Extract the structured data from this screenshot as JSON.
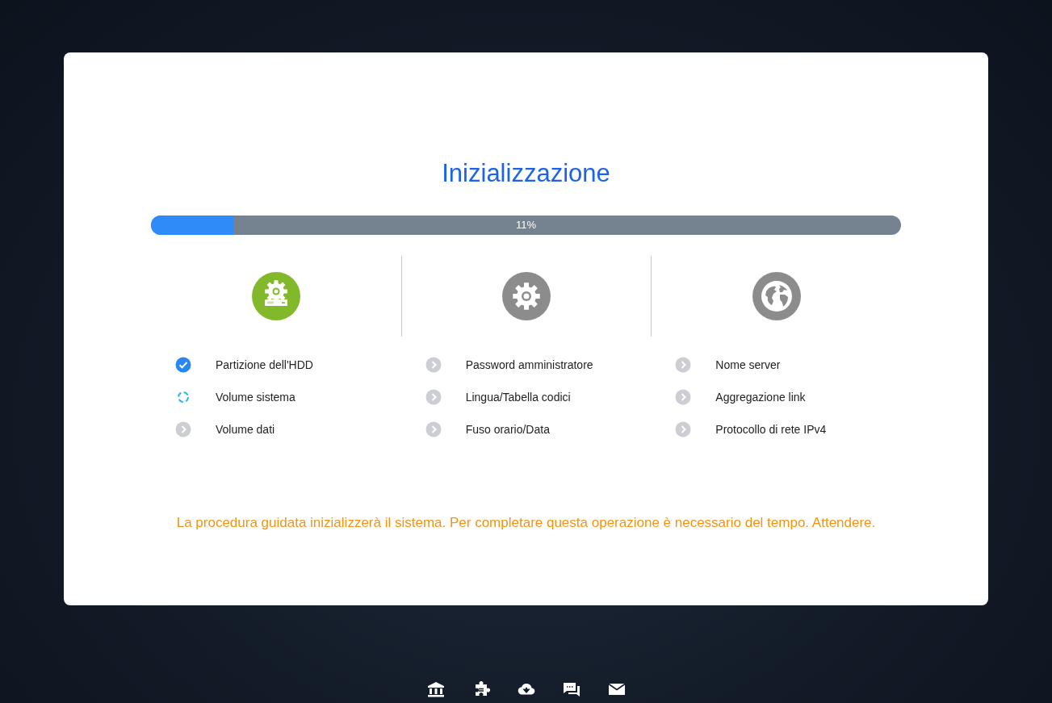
{
  "title": "Inizializzazione",
  "progress": {
    "level": 0.11,
    "label": "11%"
  },
  "sections": [
    {
      "kind": "storage",
      "active": true,
      "steps": [
        {
          "label": "Partizione dell'HDD",
          "done": true,
          "running": false
        },
        {
          "label": "Volume sistema",
          "done": false,
          "running": true
        },
        {
          "label": "Volume dati",
          "done": false,
          "running": false
        }
      ]
    },
    {
      "kind": "settings",
      "active": false,
      "steps": [
        {
          "label": "Password amministratore",
          "done": false,
          "running": false
        },
        {
          "label": "Lingua/Tabella codici",
          "done": false,
          "running": false
        },
        {
          "label": "Fuso orario/Data",
          "done": false,
          "running": false
        }
      ]
    },
    {
      "kind": "network",
      "active": false,
      "steps": [
        {
          "label": "Nome server",
          "done": false,
          "running": false
        },
        {
          "label": "Aggregazione link",
          "done": false,
          "running": false
        },
        {
          "label": "Protocollo di rete IPv4",
          "done": false,
          "running": false
        }
      ]
    }
  ],
  "message": "La procedura guidata inizializzerà il sistema. Per completare questa operazione è necessario del tempo. Attendere."
}
